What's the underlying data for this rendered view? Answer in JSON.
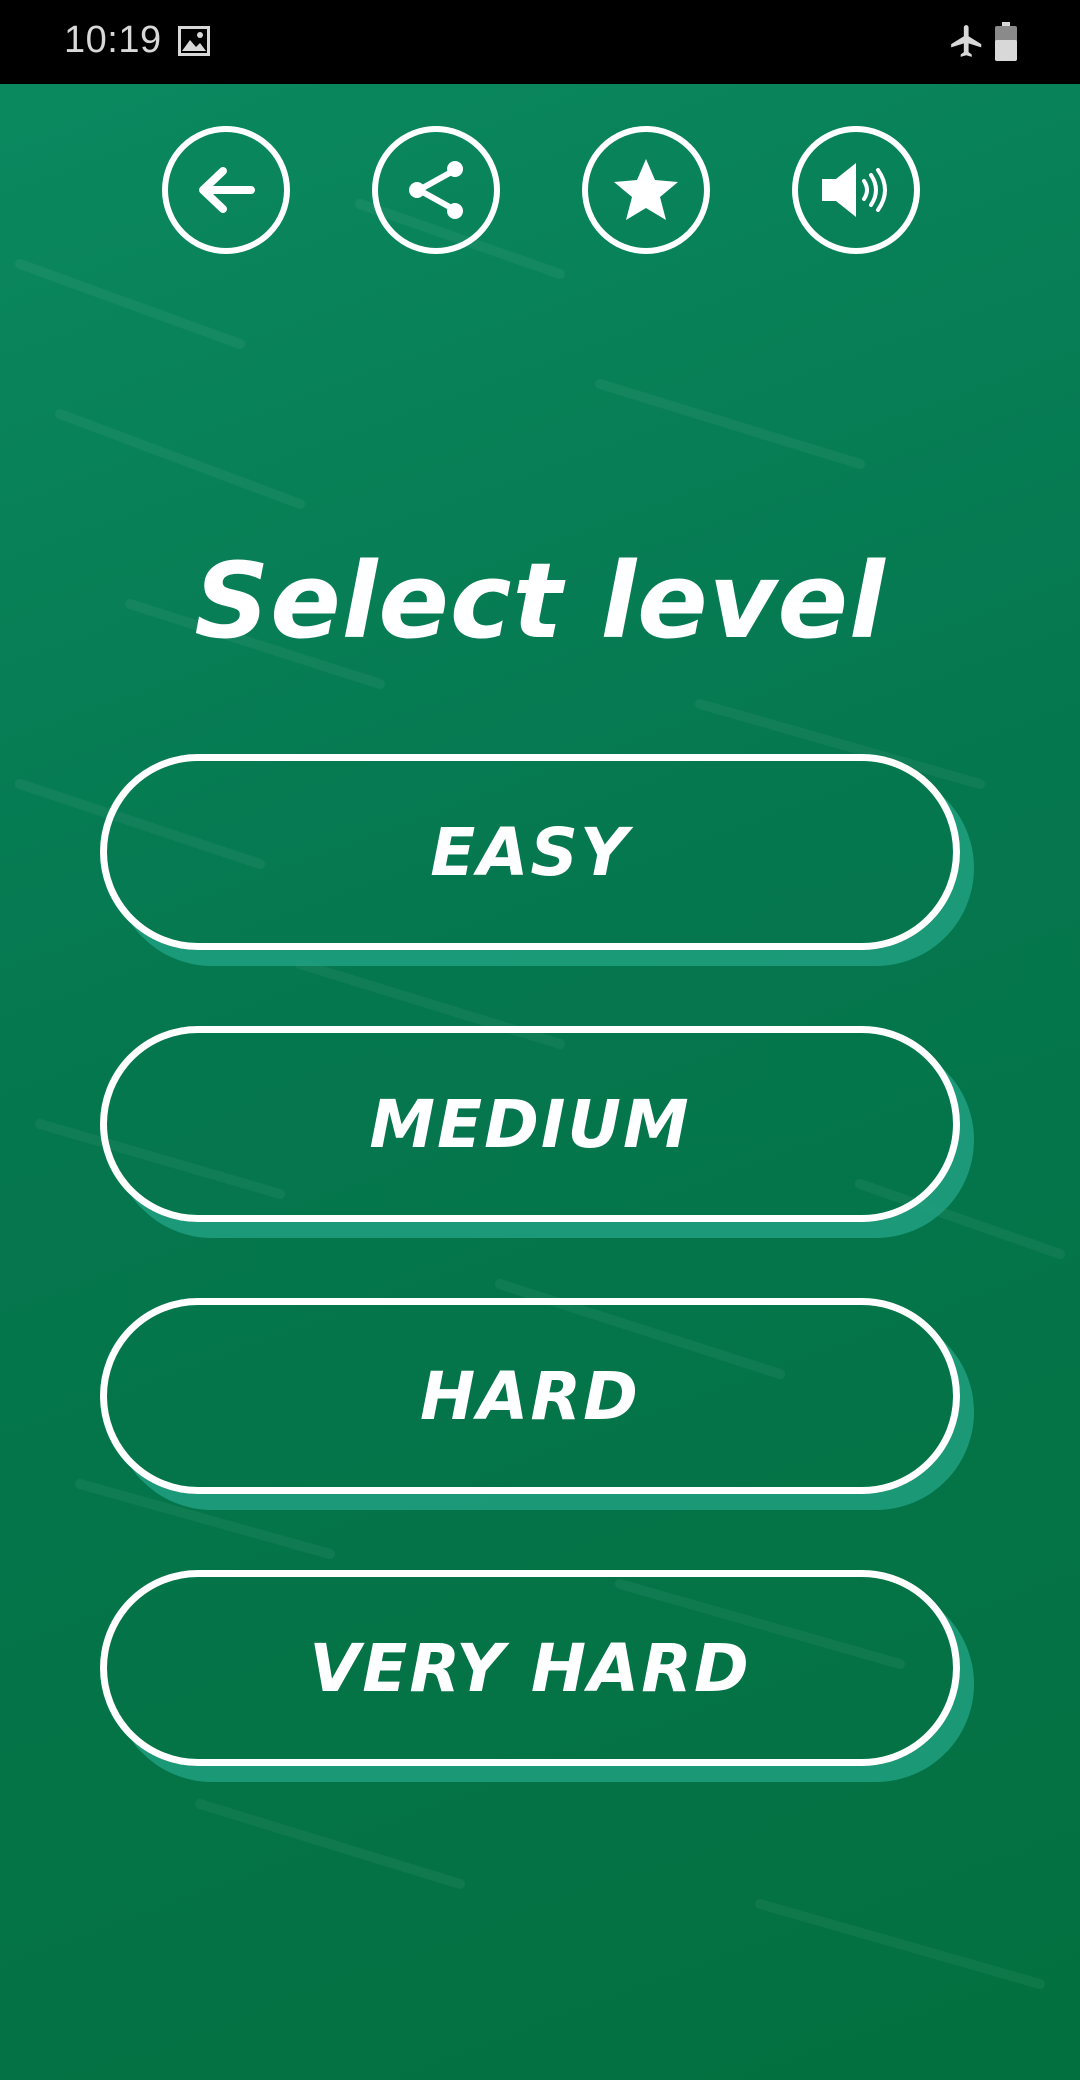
{
  "status_bar": {
    "time": "10:19",
    "icons": [
      "gallery-icon",
      "airplane-mode-icon",
      "battery-icon"
    ]
  },
  "toolbar": {
    "buttons": [
      {
        "icon": "back-arrow-icon"
      },
      {
        "icon": "share-icon"
      },
      {
        "icon": "star-icon"
      },
      {
        "icon": "speaker-icon"
      }
    ]
  },
  "title": "Select level",
  "levels": [
    {
      "label": "EASY"
    },
    {
      "label": "MEDIUM"
    },
    {
      "label": "HARD"
    },
    {
      "label": "VERY HARD"
    }
  ],
  "colors": {
    "background": "#05774f",
    "button_shadow": "#20a080",
    "foreground": "#ffffff",
    "status_bar": "#000000"
  }
}
